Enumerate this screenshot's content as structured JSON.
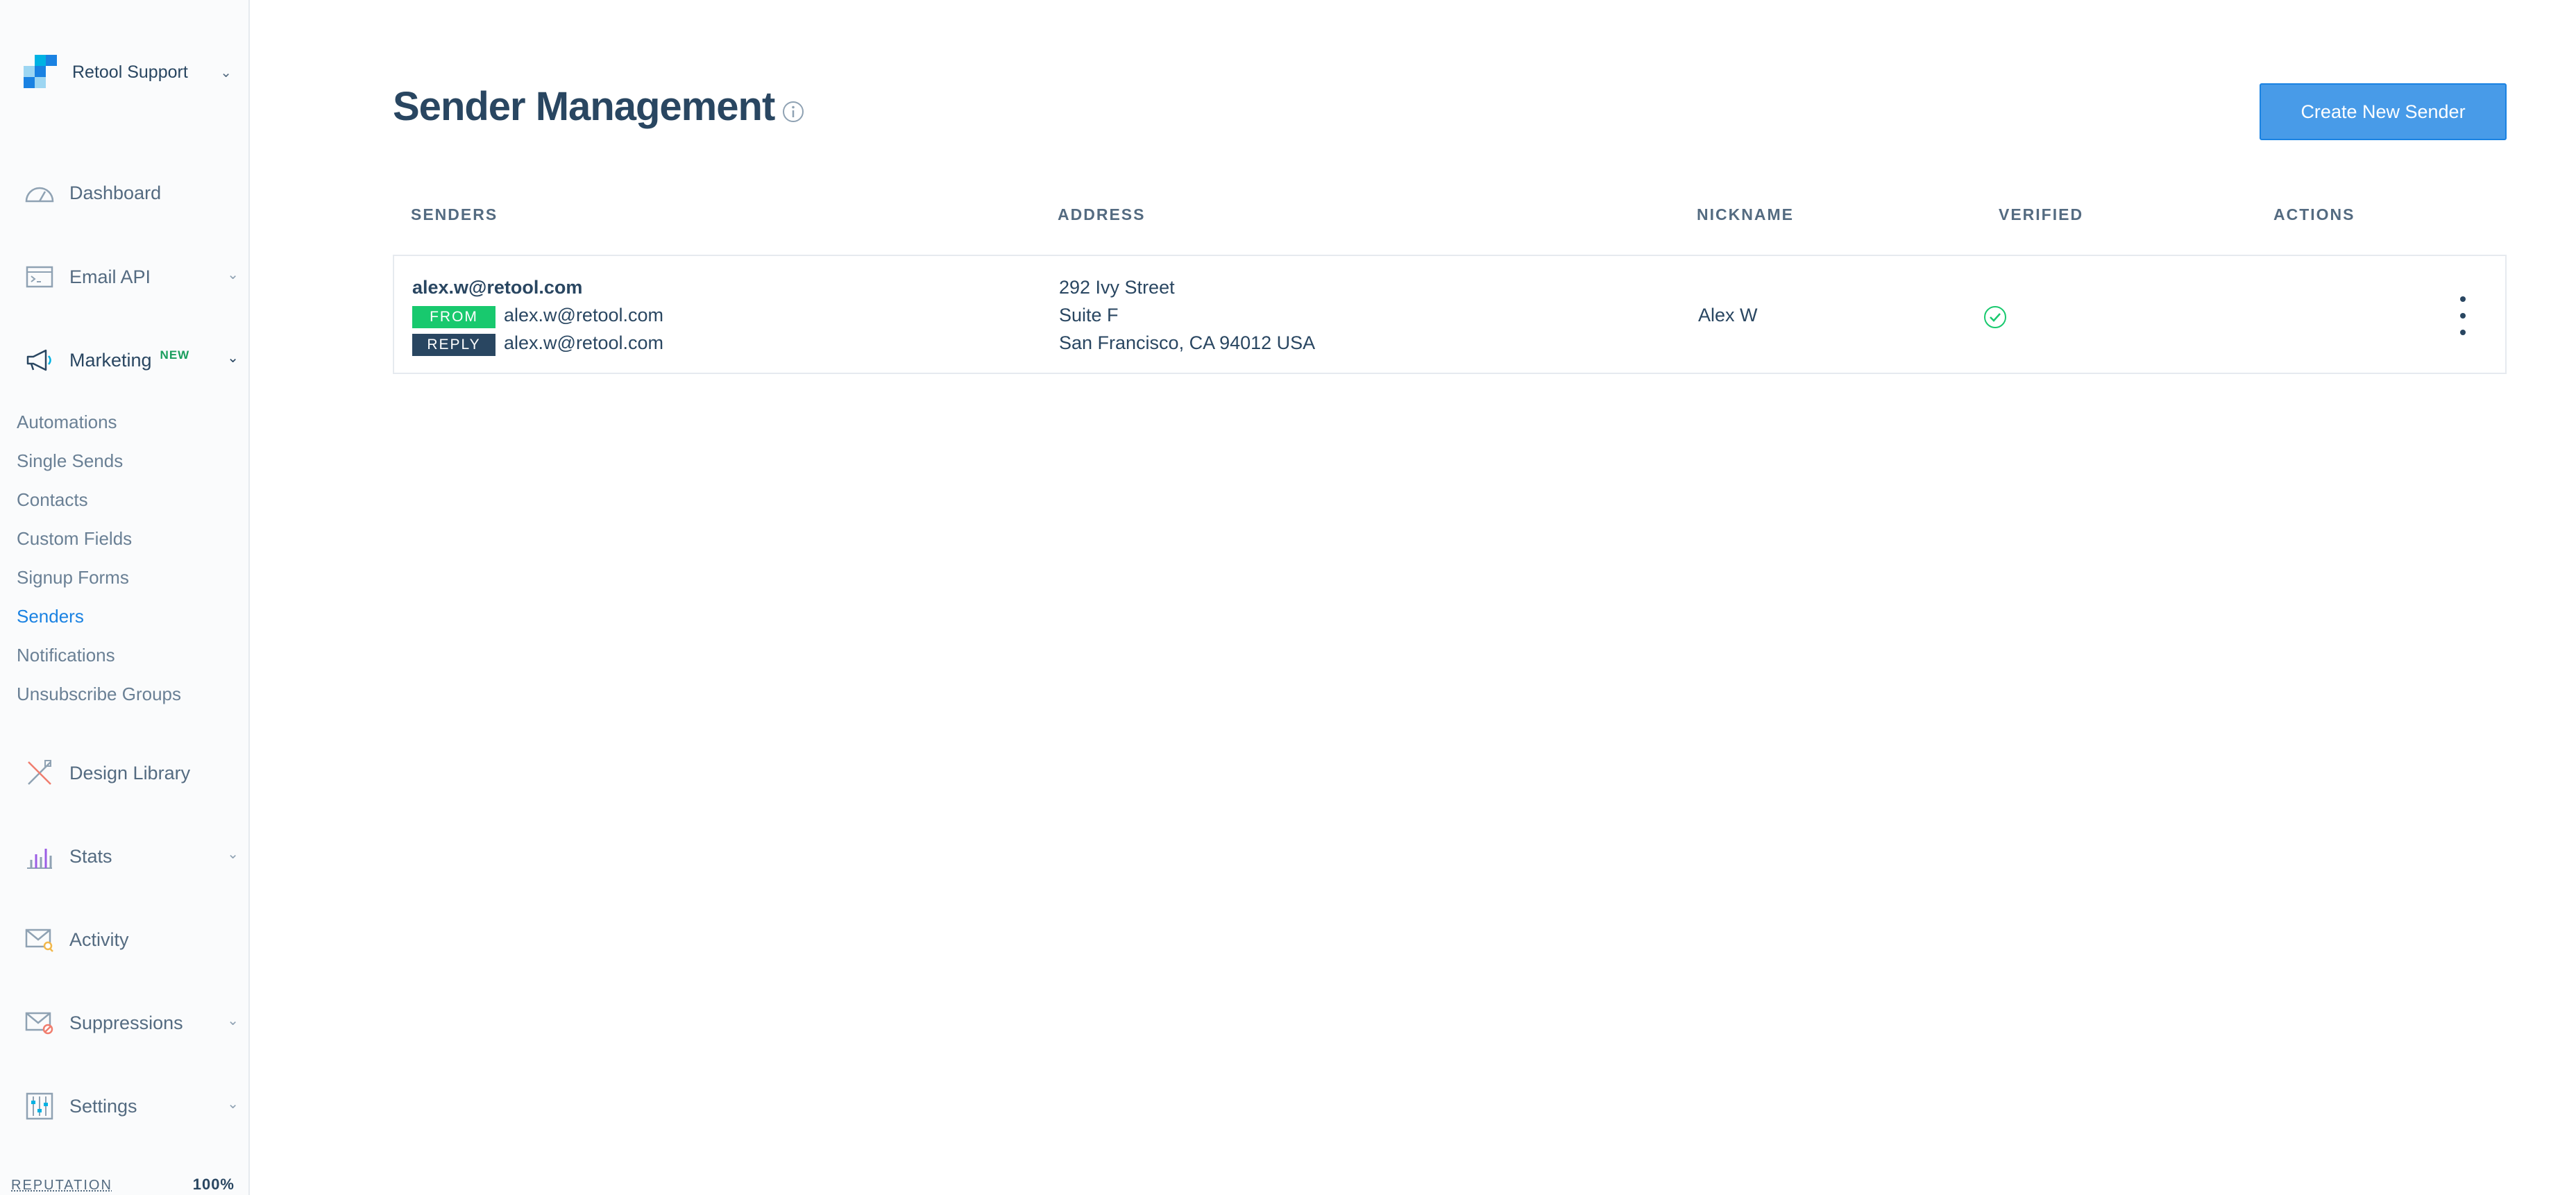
{
  "account": {
    "name": "Retool Support"
  },
  "nav": {
    "dashboard": "Dashboard",
    "email_api": "Email API",
    "marketing": "Marketing",
    "marketing_badge": "NEW",
    "design_library": "Design Library",
    "stats": "Stats",
    "activity": "Activity",
    "suppressions": "Suppressions",
    "settings": "Settings"
  },
  "marketing_sub": {
    "automations": "Automations",
    "single_sends": "Single Sends",
    "contacts": "Contacts",
    "custom_fields": "Custom Fields",
    "signup_forms": "Signup Forms",
    "senders": "Senders",
    "notifications": "Notifications",
    "unsubscribe_groups": "Unsubscribe Groups"
  },
  "reputation": {
    "label": "REPUTATION",
    "value": "100%"
  },
  "page": {
    "title": "Sender Management",
    "create_button": "Create New Sender"
  },
  "table": {
    "headers": {
      "senders": "SENDERS",
      "address": "ADDRESS",
      "nickname": "NICKNAME",
      "verified": "VERIFIED",
      "actions": "ACTIONS"
    },
    "rows": [
      {
        "sender": "alex.w@retool.com",
        "from_tag": "FROM",
        "from_email": "alex.w@retool.com",
        "reply_tag": "REPLY",
        "reply_email": "alex.w@retool.com",
        "address_line1": "292 Ivy Street",
        "address_line2": "Suite F",
        "address_line3": "San Francisco, CA 94012 USA",
        "nickname": "Alex W"
      }
    ]
  },
  "colors": {
    "accent": "#1a82e2",
    "button": "#489be8",
    "from_tag": "#18c96e",
    "reply_tag": "#294661",
    "verified": "#18c96e",
    "text": "#294661"
  }
}
